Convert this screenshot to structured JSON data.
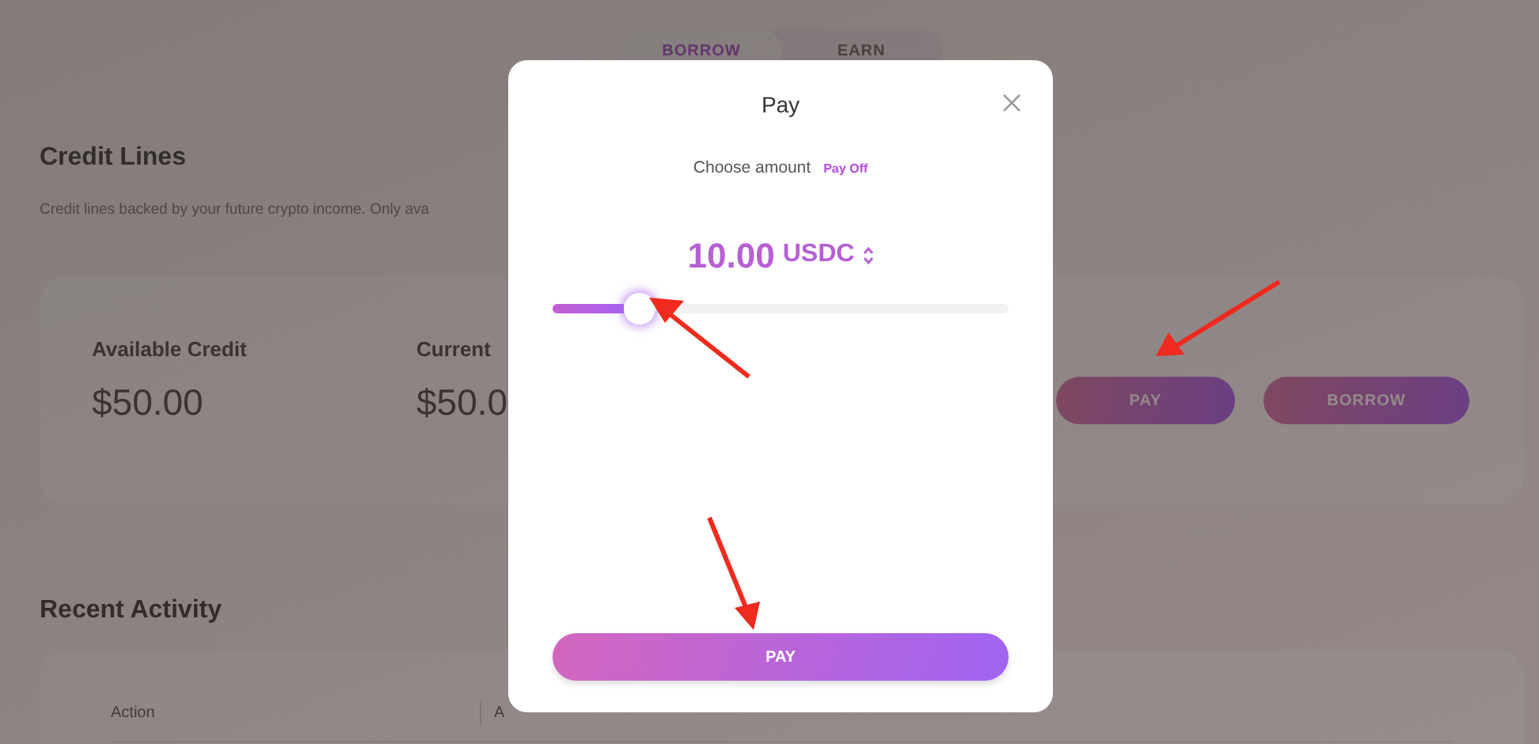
{
  "tabs": [
    {
      "label": "BORROW",
      "selected": true
    },
    {
      "label": "EARN",
      "selected": false
    }
  ],
  "credit_lines": {
    "title": "Credit Lines",
    "subtitle": "Credit lines backed by your future crypto income. Only ava",
    "stats": [
      {
        "label": "Available Credit",
        "value": "$50.00"
      },
      {
        "label": "Current",
        "value": "$50.0"
      }
    ],
    "buttons": [
      "PAY",
      "BORROW"
    ]
  },
  "recent_activity": {
    "title": "Recent Activity",
    "columns": [
      "Action",
      "A"
    ]
  },
  "dialog": {
    "title": "Pay",
    "prompt": "Choose amount",
    "pay_off_link": "Pay Off",
    "amount": "10.00",
    "currency": "USDC",
    "slider": {
      "level": 0.19
    },
    "button": "PAY"
  }
}
